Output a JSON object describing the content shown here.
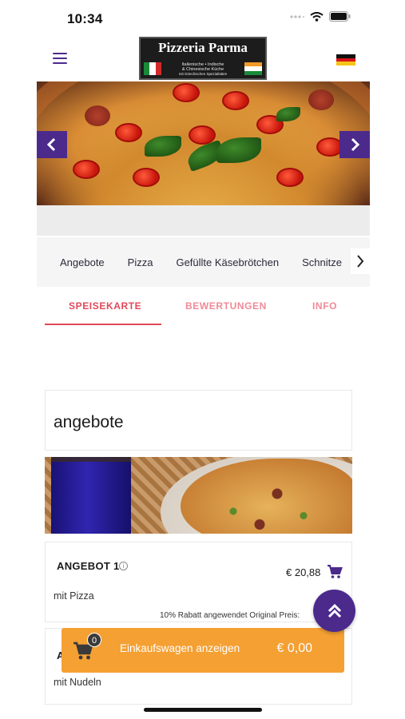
{
  "status_bar": {
    "time": "10:34"
  },
  "header": {
    "logo_title": "Pizzeria Parma",
    "logo_subtitle_1": "Italienische • Indische",
    "logo_subtitle_2": "& Chinesische Küche",
    "logo_subtitle_3": "mit Griechischen Spezialitäten"
  },
  "category_nav": {
    "items": [
      "Angebote",
      "Pizza",
      "Gefüllte Käsebrötchen",
      "Schnitze"
    ]
  },
  "tabs": {
    "menu": "SPEISEKARTE",
    "reviews": "BEWERTUNGEN",
    "info": "INFO"
  },
  "section": {
    "title": "angebote"
  },
  "products": [
    {
      "name": "ANGEBOT 1",
      "price": "€ 20,88",
      "description": "mit Pizza",
      "discount_note": "10% Rabatt angewendet Original Preis:"
    },
    {
      "letter": "A",
      "description": "mit Nudeln"
    }
  ],
  "cart_bar": {
    "count": "0",
    "label": "Einkaufswagen anzeigen",
    "total": "€ 0,00"
  },
  "colors": {
    "accent_purple": "#4b2a8c",
    "tab_active": "#e2485a",
    "cart_orange": "#f5a033"
  },
  "icons": {
    "menu": "hamburger-icon",
    "language": "german-flag-icon",
    "carousel_prev": "chevron-left-icon",
    "carousel_next": "chevron-right-icon",
    "category_next": "chevron-right-icon",
    "cart": "cart-icon",
    "info": "info-icon",
    "scroll_top": "double-chevron-up-icon"
  }
}
